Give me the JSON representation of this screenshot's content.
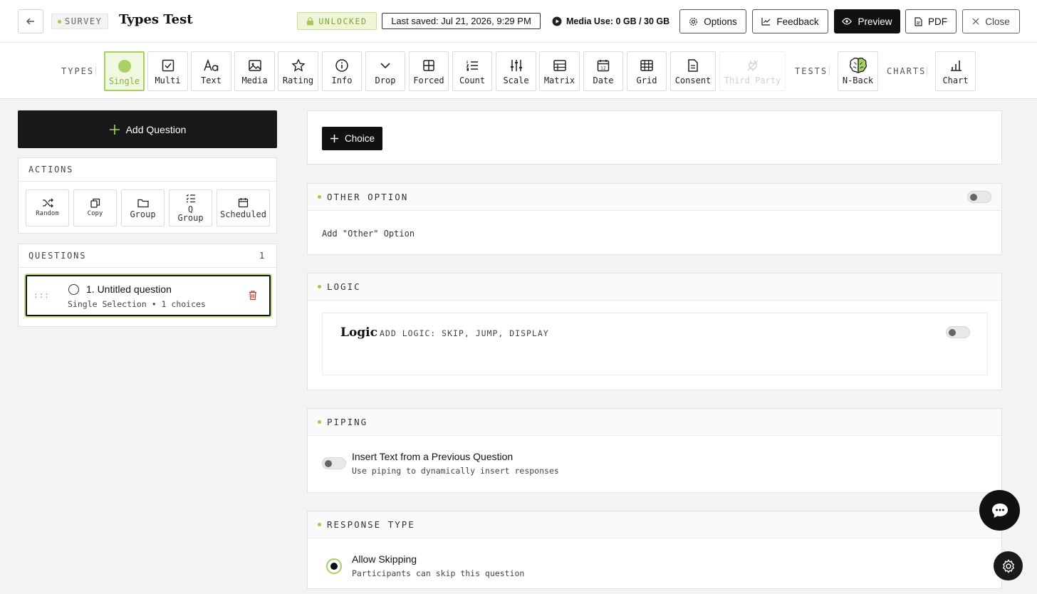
{
  "header": {
    "survey_badge": "SURVEY",
    "title": "Types Test",
    "unlocked": "UNLOCKED",
    "last_saved": "Last saved: Jul 21, 2026, 9:29 PM",
    "media_use": "Media Use: 0 GB / 30 GB",
    "options": "Options",
    "feedback": "Feedback",
    "preview": "Preview",
    "pdf": "PDF",
    "close": "Close"
  },
  "toolbar": {
    "types_label": "TYPES",
    "types": [
      {
        "label": "Single",
        "icon": "filled-circle-icon",
        "active": true
      },
      {
        "label": "Multi",
        "icon": "checkbox-icon"
      },
      {
        "label": "Text",
        "icon": "text-aa-icon"
      },
      {
        "label": "Media",
        "icon": "image-icon"
      },
      {
        "label": "Rating",
        "icon": "star-icon"
      },
      {
        "label": "Info",
        "icon": "info-icon"
      },
      {
        "label": "Drop",
        "icon": "chevron-down-icon"
      },
      {
        "label": "Forced",
        "icon": "grid-2x2-icon"
      },
      {
        "label": "Count",
        "icon": "numbered-list-icon"
      },
      {
        "label": "Scale",
        "icon": "sliders-icon"
      },
      {
        "label": "Matrix",
        "icon": "matrix-icon"
      },
      {
        "label": "Date",
        "icon": "calendar-icon"
      },
      {
        "label": "Grid",
        "icon": "table-grid-icon"
      },
      {
        "label": "Consent",
        "icon": "document-icon"
      },
      {
        "label": "Third Party",
        "icon": "plug-icon",
        "disabled": true
      }
    ],
    "tests_label": "TESTS",
    "nback": "N-Back",
    "charts_label": "CHARTS",
    "chart": "Chart"
  },
  "sidebar": {
    "add_question": "Add Question",
    "actions_title": "ACTIONS",
    "actions": [
      {
        "label": "Random",
        "icon": "shuffle-icon"
      },
      {
        "label": "Copy",
        "icon": "copy-icon"
      },
      {
        "label": "Group",
        "icon": "folder-icon"
      },
      {
        "label": "Q\nGroup",
        "icon": "question-list-icon"
      },
      {
        "label": "Scheduled",
        "icon": "calendar-icon"
      }
    ],
    "questions_title": "QUESTIONS",
    "questions_count": "1",
    "question": {
      "handle": ":::",
      "title": "1. Untitled question",
      "subtitle": "Single Selection • 1 choices"
    }
  },
  "editor": {
    "choice_button": "Choice",
    "other_option": {
      "title": "OTHER OPTION",
      "label": "Add \"Other\" Option"
    },
    "logic": {
      "title": "LOGIC",
      "heading": "Logic",
      "desc": "ADD LOGIC: SKIP, JUMP, DISPLAY"
    },
    "piping": {
      "title": "PIPING",
      "heading": "Insert Text from a Previous Question",
      "desc": "Use piping to dynamically insert responses"
    },
    "response_type": {
      "title": "RESPONSE TYPE",
      "heading": "Allow Skipping",
      "desc": "Participants can skip this question"
    }
  },
  "colors": {
    "accent": "#a9d162",
    "dark": "#111111",
    "danger": "#c0392b"
  }
}
